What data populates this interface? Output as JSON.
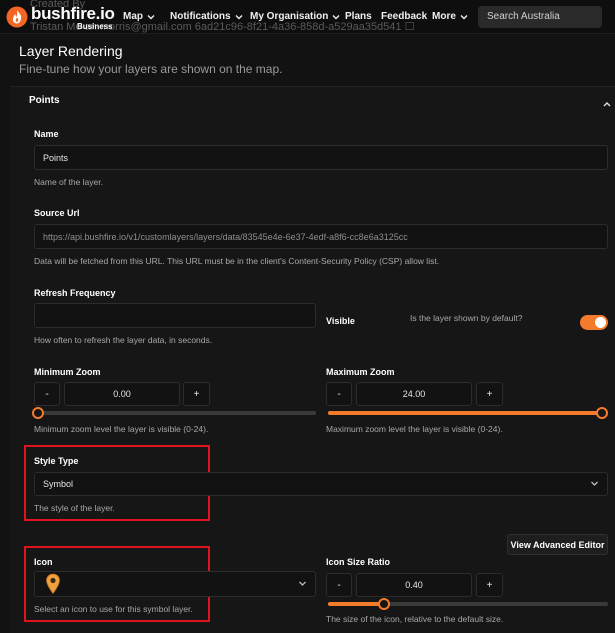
{
  "nav": {
    "ghost_created": "Created By",
    "ghost_user": "Tristan Mo          an.morris@gmail.com 6ad21c96-8f21-4a36-858d-a529aa35d541 ☐",
    "logo": "bushfire.io",
    "logo_sub": "Business",
    "items": [
      {
        "label": "Map",
        "has_dropdown": true
      },
      {
        "label": "Notifications",
        "has_dropdown": true
      },
      {
        "label": "My Organisation",
        "has_dropdown": true
      },
      {
        "label": "Plans",
        "has_dropdown": false
      },
      {
        "label": "Feedback",
        "has_dropdown": false
      },
      {
        "label": "More",
        "has_dropdown": true
      }
    ],
    "search_placeholder": "Search Australia"
  },
  "page": {
    "title": "Layer Rendering",
    "subtitle": "Fine-tune how your layers are shown on the map."
  },
  "section": {
    "title": "Points"
  },
  "form": {
    "name": {
      "label": "Name",
      "value": "Points",
      "help": "Name of the layer."
    },
    "source_url": {
      "label": "Source Url",
      "value": "https://api.bushfire.io/v1/customlayers/layers/data/83545e4e-6e37-4edf-a8f6-cc8e6a3125cc",
      "help": "Data will be fetched from this URL. This URL must be in the client's Content-Security Policy (CSP) allow list."
    },
    "refresh": {
      "label": "Refresh Frequency",
      "value": "",
      "help": "How often to refresh the layer data, in seconds."
    },
    "visible": {
      "label": "Visible",
      "help": "Is the layer shown by default?",
      "checked": true
    },
    "min_zoom": {
      "label": "Minimum Zoom",
      "value": "0.00",
      "minus": "-",
      "plus": "+",
      "slider_fraction": 0.0,
      "help": "Minimum zoom level the layer is visible (0-24)."
    },
    "max_zoom": {
      "label": "Maximum Zoom",
      "value": "24.00",
      "minus": "-",
      "plus": "+",
      "slider_fraction": 1.0,
      "help": "Maximum zoom level the layer is visible (0-24)."
    },
    "style_type": {
      "label": "Style Type",
      "value": "Symbol",
      "help": "The style of the layer."
    },
    "advanced_editor": "View Advanced Editor",
    "icon": {
      "label": "Icon",
      "help": "Select an icon to use for this symbol layer."
    },
    "icon_size": {
      "label": "Icon Size Ratio",
      "value": "0.40",
      "minus": "-",
      "plus": "+",
      "slider_fraction": 0.2,
      "help": "The size of the icon, relative to the default size."
    }
  },
  "colors": {
    "accent": "#f47a2c",
    "highlight": "#e0141e",
    "background": "#121212"
  }
}
